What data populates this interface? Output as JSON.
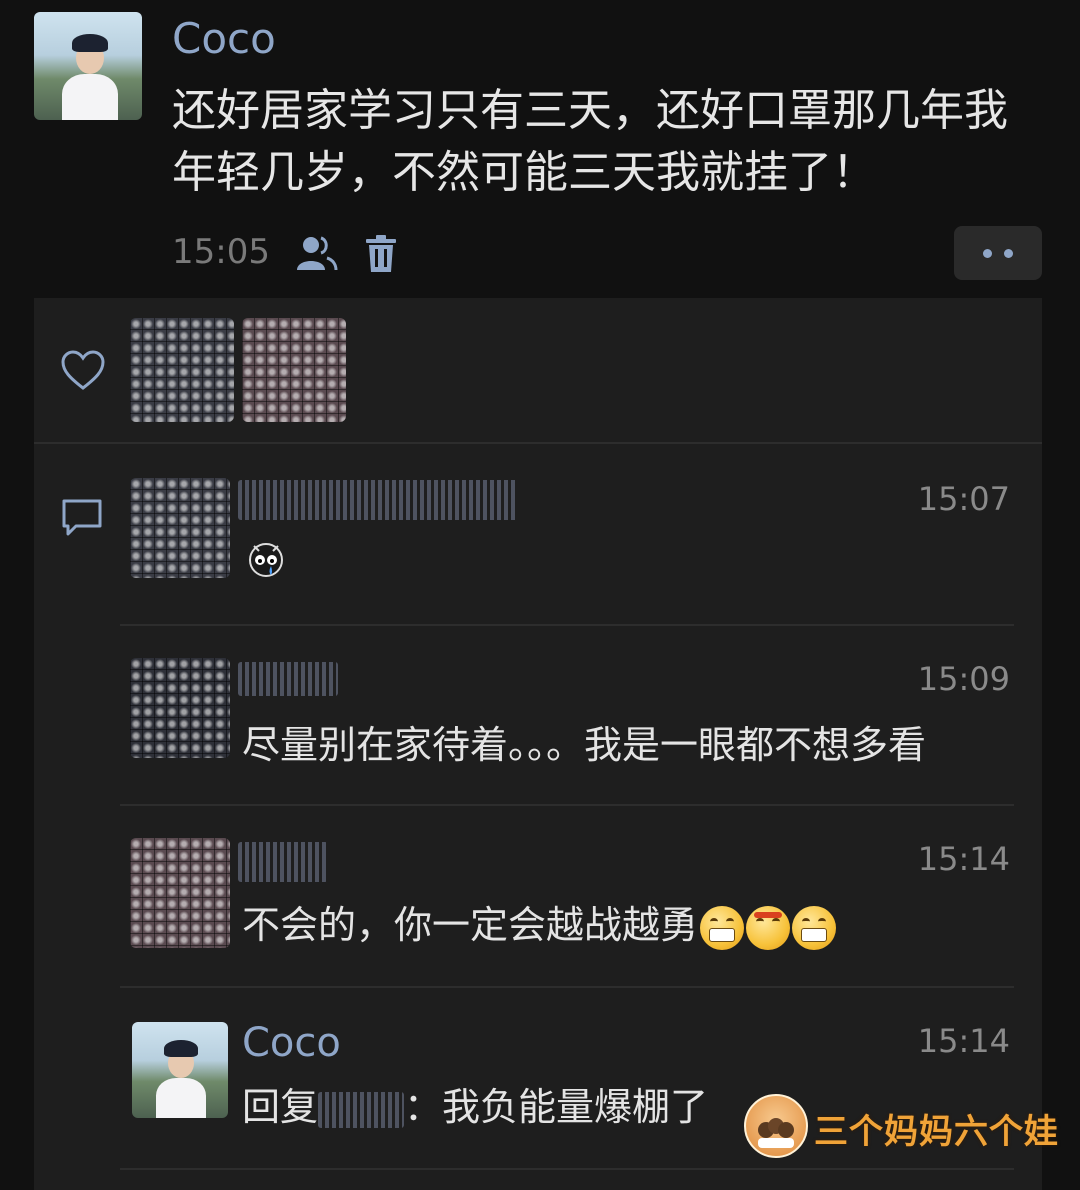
{
  "post": {
    "author": "Coco",
    "text_line1": "还好居家学习只有三天，还好口罩那几年我",
    "text_line2": "年轻几岁，不然可能三天我就挂了！",
    "time": "15:05",
    "icons": [
      "contacts-icon",
      "trash-icon",
      "more-dots-icon"
    ]
  },
  "likes": {
    "icon": "heart-icon"
  },
  "comments": {
    "icon": "comment-bubble-icon",
    "items": [
      {
        "time": "15:07",
        "text": "",
        "emoji": [
          "crying-face-emoji"
        ]
      },
      {
        "time": "15:09",
        "text": "尽量别在家待着。。。我是一眼都不想多看"
      },
      {
        "time": "15:14",
        "text": "不会的，你一定会越战越勇",
        "emoji": [
          "grinning-emoji",
          "angry-emoji",
          "grinning-emoji"
        ]
      },
      {
        "time": "15:14",
        "author": "Coco",
        "reply_prefix": "回复",
        "reply_suffix": "：我负能量爆棚了"
      }
    ]
  },
  "watermark": {
    "text": "三个妈妈六个娃",
    "color": "#f0a338"
  },
  "colors": {
    "background": "#111111",
    "panel": "#1e1e1e",
    "name": "#8fa6c8",
    "time": "#7a7a7a"
  }
}
